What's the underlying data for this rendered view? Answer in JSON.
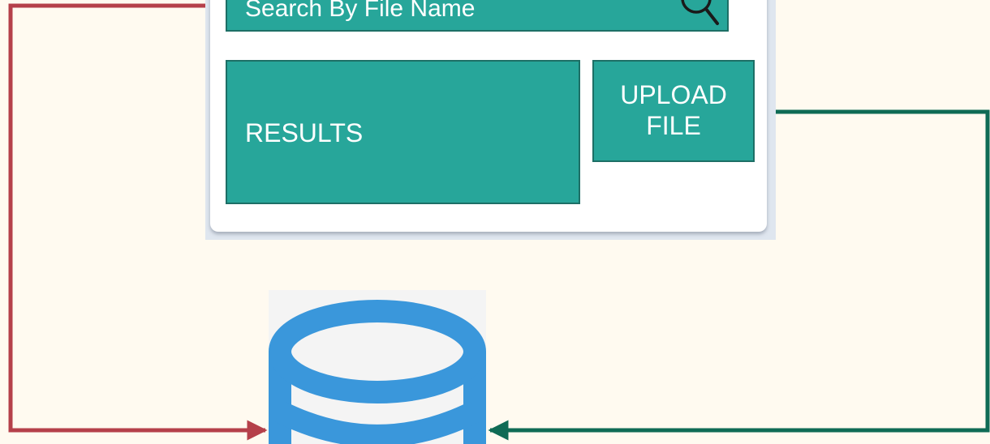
{
  "search": {
    "label": "Search By File Name",
    "icon": "search-icon"
  },
  "results": {
    "label": "RESULTS"
  },
  "upload": {
    "label": "UPLOAD\nFILE"
  },
  "database": {
    "icon": "database-icon"
  },
  "colors": {
    "background": "#fffaf0",
    "teal": "#27a69a",
    "teal_border": "#1d6f66",
    "search_arrow": "#b5404a",
    "upload_arrow": "#0f6b55",
    "database": "#3a97db"
  }
}
